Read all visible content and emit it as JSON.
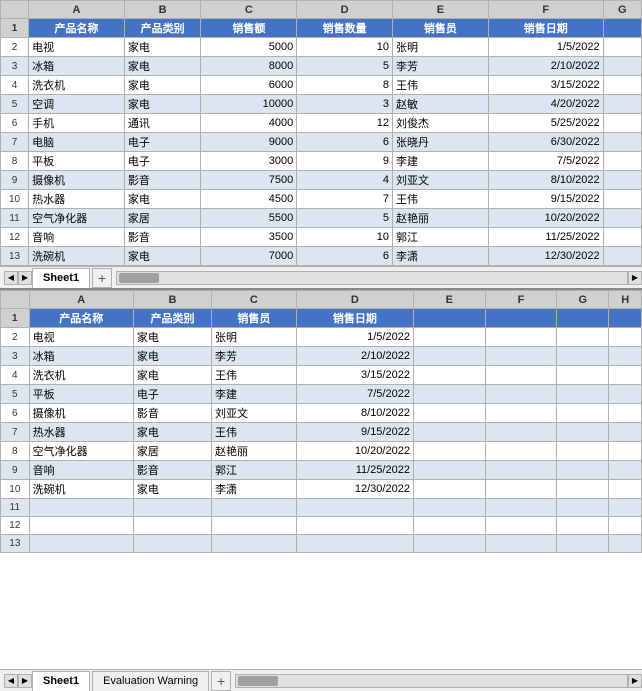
{
  "app": {
    "title": "Spreadsheet"
  },
  "top_sheet": {
    "col_headers": [
      "",
      "A",
      "B",
      "C",
      "D",
      "E",
      "F",
      "G"
    ],
    "header_labels": [
      "产品名称",
      "产品类别",
      "销售额",
      "销售数量",
      "销售员",
      "销售日期"
    ],
    "rows": [
      {
        "num": 2,
        "a": "电视",
        "b": "家电",
        "c": "5000",
        "d": "10",
        "e": "张明",
        "f": "1/5/2022"
      },
      {
        "num": 3,
        "a": "冰箱",
        "b": "家电",
        "c": "8000",
        "d": "5",
        "e": "李芳",
        "f": "2/10/2022"
      },
      {
        "num": 4,
        "a": "洗衣机",
        "b": "家电",
        "c": "6000",
        "d": "8",
        "e": "王伟",
        "f": "3/15/2022"
      },
      {
        "num": 5,
        "a": "空调",
        "b": "家电",
        "c": "10000",
        "d": "3",
        "e": "赵敏",
        "f": "4/20/2022"
      },
      {
        "num": 6,
        "a": "手机",
        "b": "通讯",
        "c": "4000",
        "d": "12",
        "e": "刘俊杰",
        "f": "5/25/2022"
      },
      {
        "num": 7,
        "a": "电脑",
        "b": "电子",
        "c": "9000",
        "d": "6",
        "e": "张晓丹",
        "f": "6/30/2022"
      },
      {
        "num": 8,
        "a": "平板",
        "b": "电子",
        "c": "3000",
        "d": "9",
        "e": "李建",
        "f": "7/5/2022"
      },
      {
        "num": 9,
        "a": "摄像机",
        "b": "影音",
        "c": "7500",
        "d": "4",
        "e": "刘亚文",
        "f": "8/10/2022"
      },
      {
        "num": 10,
        "a": "热水器",
        "b": "家电",
        "c": "4500",
        "d": "7",
        "e": "王伟",
        "f": "9/15/2022"
      },
      {
        "num": 11,
        "a": "空气净化器",
        "b": "家居",
        "c": "5500",
        "d": "5",
        "e": "赵艳丽",
        "f": "10/20/2022"
      },
      {
        "num": 12,
        "a": "音响",
        "b": "影音",
        "c": "3500",
        "d": "10",
        "e": "郭江",
        "f": "11/25/2022"
      },
      {
        "num": 13,
        "a": "洗碗机",
        "b": "家电",
        "c": "7000",
        "d": "6",
        "e": "李潇",
        "f": "12/30/2022"
      }
    ],
    "tab": "Sheet1"
  },
  "bottom_sheet": {
    "col_headers": [
      "",
      "A",
      "B",
      "C",
      "D",
      "E",
      "F",
      "G",
      "H"
    ],
    "header_labels": [
      "产品名称",
      "产品类别",
      "销售员",
      "销售日期"
    ],
    "rows": [
      {
        "num": 2,
        "a": "电视",
        "b": "家电",
        "c": "张明",
        "d": "1/5/2022"
      },
      {
        "num": 3,
        "a": "冰箱",
        "b": "家电",
        "c": "李芳",
        "d": "2/10/2022"
      },
      {
        "num": 4,
        "a": "洗衣机",
        "b": "家电",
        "c": "王伟",
        "d": "3/15/2022"
      },
      {
        "num": 5,
        "a": "平板",
        "b": "电子",
        "c": "李建",
        "d": "7/5/2022"
      },
      {
        "num": 6,
        "a": "摄像机",
        "b": "影音",
        "c": "刘亚文",
        "d": "8/10/2022"
      },
      {
        "num": 7,
        "a": "热水器",
        "b": "家电",
        "c": "王伟",
        "d": "9/15/2022"
      },
      {
        "num": 8,
        "a": "空气净化器",
        "b": "家居",
        "c": "赵艳丽",
        "d": "10/20/2022"
      },
      {
        "num": 9,
        "a": "音响",
        "b": "影音",
        "c": "郭江",
        "d": "11/25/2022"
      },
      {
        "num": 10,
        "a": "洗碗机",
        "b": "家电",
        "c": "李潇",
        "d": "12/30/2022"
      },
      {
        "num": 11,
        "a": "",
        "b": "",
        "c": "",
        "d": ""
      },
      {
        "num": 12,
        "a": "",
        "b": "",
        "c": "",
        "d": ""
      },
      {
        "num": 13,
        "a": "",
        "b": "",
        "c": "",
        "d": ""
      }
    ],
    "tabs": [
      {
        "label": "Sheet1",
        "active": true
      },
      {
        "label": "Evaluation Warning",
        "active": false
      }
    ]
  }
}
